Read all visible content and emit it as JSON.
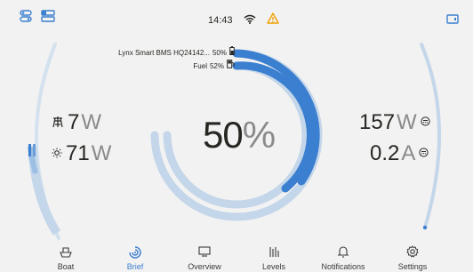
{
  "status": {
    "time": "14:43"
  },
  "tanks": [
    {
      "name": "Lynx Smart BMS HQ24142...",
      "level": "50%"
    },
    {
      "name": "Fuel",
      "level": "52%"
    }
  ],
  "center": {
    "value": "50",
    "unit": "%"
  },
  "left": {
    "solar": {
      "value": "7",
      "unit": "W"
    },
    "ac_in": {
      "value": "71",
      "unit": "W"
    }
  },
  "right": {
    "power": {
      "value": "157",
      "unit": "W"
    },
    "current": {
      "value": "0.2",
      "unit": "A"
    }
  },
  "nav": {
    "items": [
      {
        "label": "Boat",
        "icon": "boat-icon"
      },
      {
        "label": "Brief",
        "icon": "brief-icon"
      },
      {
        "label": "Overview",
        "icon": "overview-icon"
      },
      {
        "label": "Levels",
        "icon": "levels-icon"
      },
      {
        "label": "Notifications",
        "icon": "bell-icon"
      },
      {
        "label": "Settings",
        "icon": "gear-icon"
      }
    ],
    "active": "Brief"
  },
  "colors": {
    "accent": "#3b7fd0",
    "accent_light": "#c4d6ea",
    "warning": "#f0a100",
    "background": "#f2f2f2"
  }
}
